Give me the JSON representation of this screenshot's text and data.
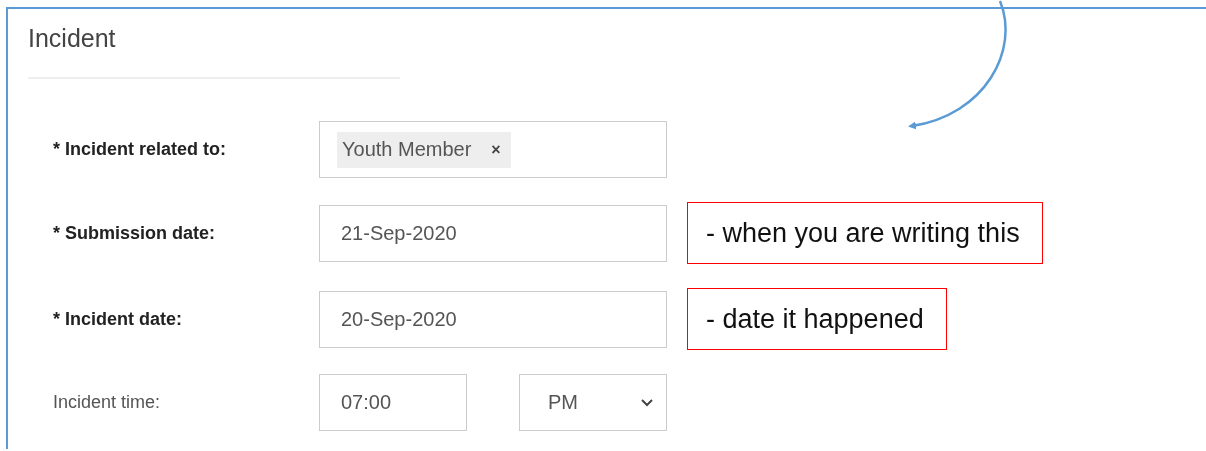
{
  "title": "Incident",
  "fields": [
    {
      "kind": "tags",
      "label": "* Incident related to:",
      "required": true,
      "tags": [
        {
          "label": "Youth Member",
          "remove": "×"
        }
      ]
    },
    {
      "kind": "text",
      "label": "* Submission date:",
      "required": true,
      "value": "21-Sep-2020",
      "note": "- when you are writing this"
    },
    {
      "kind": "text",
      "label": "* Incident date:",
      "required": true,
      "value": "20-Sep-2020",
      "note": "- date it happened"
    },
    {
      "kind": "time",
      "label": "Incident time:",
      "required": false,
      "value": "07:00",
      "period": "PM"
    }
  ]
}
